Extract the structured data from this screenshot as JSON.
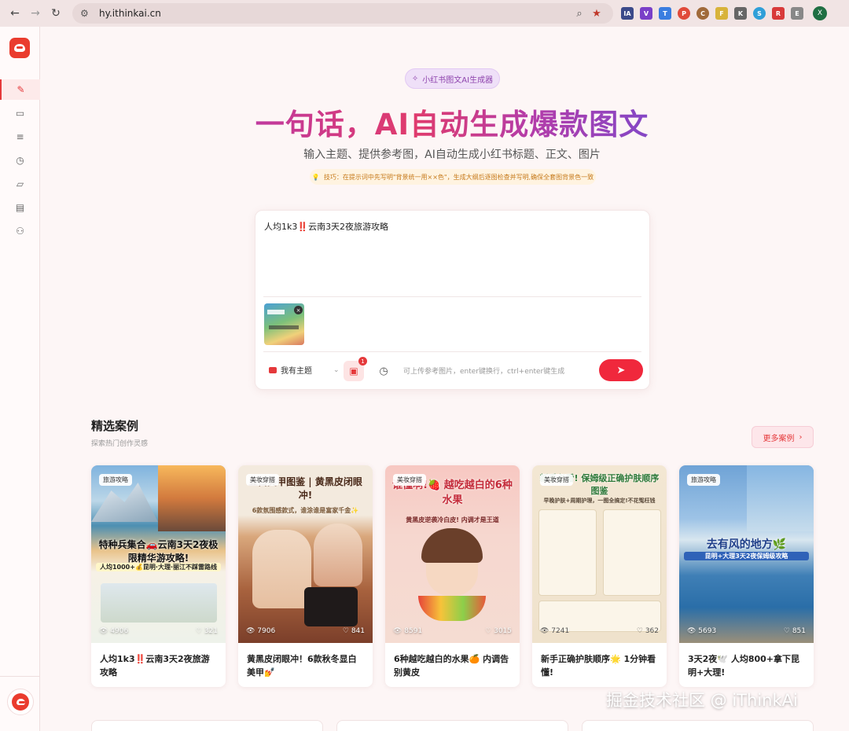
{
  "browser": {
    "url": "hy.ithinkai.cn",
    "extensions": [
      "IA",
      "V",
      "T",
      "P",
      "C",
      "F",
      "K",
      "S",
      "R",
      "E"
    ],
    "profile_initial": "X"
  },
  "sidebar": {
    "items": [
      {
        "icon": "pen-icon",
        "glyph": "✎"
      },
      {
        "icon": "card-icon",
        "glyph": "▭"
      },
      {
        "icon": "list-icon",
        "glyph": "≡"
      },
      {
        "icon": "clock-icon",
        "glyph": "◷"
      },
      {
        "icon": "folder-icon",
        "glyph": "▱"
      },
      {
        "icon": "document-icon",
        "glyph": "▤"
      },
      {
        "icon": "users-icon",
        "glyph": "⚇"
      }
    ]
  },
  "hero": {
    "badge": "小红书图文AI生成器",
    "title": "一句话，AI自动生成爆款图文",
    "subtitle": "输入主题、提供参考图，AI自动生成小红书标题、正文、图片",
    "tip": "技巧：在提示词中先写明\"背景统一用××色\"，生成大纲后逐图检查并写明,确保全套图背景色一致"
  },
  "composer": {
    "text": "人均1k3‼️云南3天2夜旅游攻略",
    "theme_label": "我有主题",
    "image_count": "1",
    "hint": "可上传参考图片，enter键换行，ctrl+enter键生成"
  },
  "featured": {
    "title": "精选案例",
    "subtitle": "探索热门创作灵感",
    "more_label": "更多案例",
    "cards": [
      {
        "tag": "旅游攻略",
        "views": "4906",
        "likes": "321",
        "title": "人均1k3‼️云南3天2夜旅游攻略",
        "headline": "特种兵集合🚗云南3天2夜极限精华游攻略!",
        "subline": "人均1000+💰昆明·大理·丽江不踩雷路线"
      },
      {
        "tag": "美妆穿搭",
        "views": "7906",
        "likes": "841",
        "title": "黄黑皮闭眼冲！6款秋冬显白美甲💅",
        "headline": "显白美甲图鉴 | 黄黑皮闭眼冲!",
        "subline": "6款氛围感款式，谁涂谁是富家千金✨"
      },
      {
        "tag": "美妆穿搭",
        "views": "8591",
        "likes": "3015",
        "title": "6种越吃越白的水果🍊 内调告别黄皮",
        "headline": "谁懂啊!🍓 越吃越白的6种水果",
        "subline": "黄黑皮逆袭冷白皮! 内调才是王道"
      },
      {
        "tag": "美妆穿搭",
        "views": "7241",
        "likes": "362",
        "title": "新手正确护肤顺序🌟 1分钟看懂!",
        "headline": "新手必看! 保姆级正确护肤顺序图鉴",
        "subline": "早晚护肤+周期护理，一图全搞定!不花冤枉钱"
      },
      {
        "tag": "旅游攻略",
        "views": "5693",
        "likes": "851",
        "title": "3天2夜🕊️ 人均800+拿下昆明+大理!",
        "headline": "去有风的地方🌿",
        "subline": "昆明+大理3天2夜保姆级攻略"
      }
    ]
  },
  "watermark": "掘金技术社区 @ iThinkAi"
}
